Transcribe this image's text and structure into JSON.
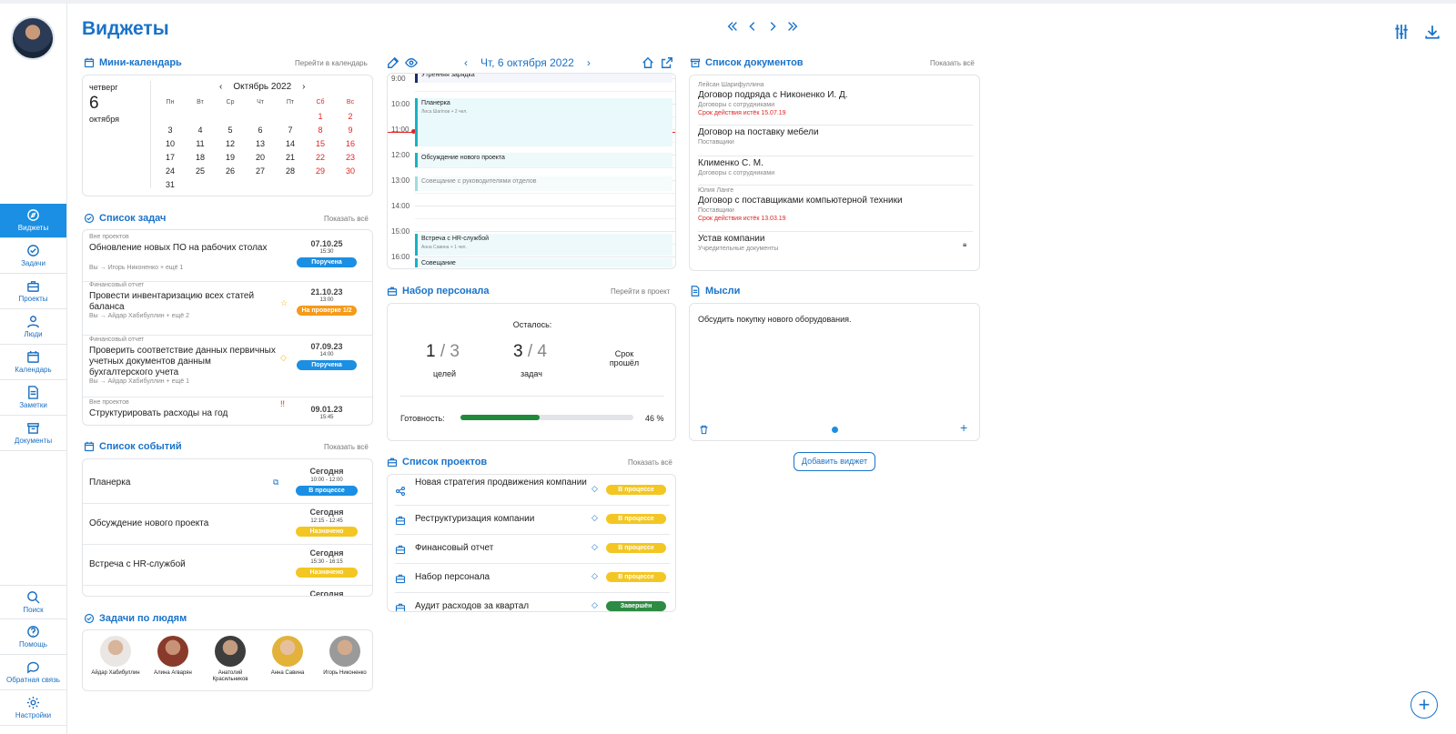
{
  "page": {
    "title": "Виджеты",
    "add_widget": "Добавить виджет"
  },
  "sidebar": {
    "items": [
      {
        "label": "Виджеты",
        "icon": "compass-icon",
        "active": true
      },
      {
        "label": "Задачи",
        "icon": "check-icon"
      },
      {
        "label": "Проекты",
        "icon": "briefcase-icon"
      },
      {
        "label": "Люди",
        "icon": "person-icon"
      },
      {
        "label": "Календарь",
        "icon": "calendar-icon"
      },
      {
        "label": "Заметки",
        "icon": "note-icon"
      },
      {
        "label": "Документы",
        "icon": "archive-icon"
      }
    ],
    "bottom": [
      {
        "label": "Поиск",
        "icon": "search-icon"
      },
      {
        "label": "Помощь",
        "icon": "help-icon"
      },
      {
        "label": "Обратная связь",
        "icon": "chat-icon"
      },
      {
        "label": "Настройки",
        "icon": "gear-icon"
      }
    ]
  },
  "mini_calendar": {
    "title": "Мини-календарь",
    "link": "Перейти в календарь",
    "weekday": "четверг",
    "day": "6",
    "month": "октября",
    "month_year": "Октябрь 2022",
    "weekdays": [
      "Пн",
      "Вт",
      "Ср",
      "Чт",
      "Пт",
      "Сб",
      "Вс"
    ],
    "weeks": [
      [
        "",
        "",
        "",
        "",
        "",
        "1",
        "2"
      ],
      [
        "3",
        "4",
        "5",
        "6",
        "7",
        "8",
        "9"
      ],
      [
        "10",
        "11",
        "12",
        "13",
        "14",
        "15",
        "16"
      ],
      [
        "17",
        "18",
        "19",
        "20",
        "21",
        "22",
        "23"
      ],
      [
        "24",
        "25",
        "26",
        "27",
        "28",
        "29",
        "30"
      ],
      [
        "31",
        "",
        "",
        "",
        "",
        "",
        ""
      ]
    ]
  },
  "tasks": {
    "title": "Список задач",
    "link": "Показать всё",
    "items": [
      {
        "project": "Вне проектов",
        "name": "Обновление новых ПО на рабочих столах",
        "people": "Вы → Игорь Никоненко + ещё 1",
        "date": "07.10.25",
        "time": "15:30",
        "status": "Поручена",
        "color": "b-blue",
        "icon": ""
      },
      {
        "project": "Финансовый отчет",
        "name": "Провести инвентаризацию всех статей баланса",
        "people": "Вы → Айдар Хабибуллин + ещё 2",
        "date": "21.10.23",
        "time": "13:00",
        "status": "На проверке 1/2",
        "color": "b-orange",
        "icon": "☆"
      },
      {
        "project": "Финансовый отчет",
        "name": "Проверить соответствие данных первичных учетных документов данным бухгалтерского учета",
        "people": "Вы → Айдар Хабибуллин + ещё 1",
        "date": "07.09.23",
        "time": "14:00",
        "status": "Поручена",
        "color": "b-blue",
        "icon": "◇"
      },
      {
        "project": "Вне проектов",
        "name": "Структурировать расходы на год",
        "people": "",
        "date": "09.01.23",
        "time": "15:45",
        "status": "",
        "color": "b-yellow",
        "icon": "!!"
      }
    ]
  },
  "events": {
    "title": "Список событий",
    "link": "Показать всё",
    "items": [
      {
        "name": "Планерка",
        "day": "Сегодня",
        "time": "10:00 - 12:00",
        "status": "В процессе",
        "color": "b-blue"
      },
      {
        "name": "Обсуждение нового проекта",
        "day": "Сегодня",
        "time": "12:15 - 12:45",
        "status": "Назначено",
        "color": "b-yellow"
      },
      {
        "name": "Встреча с HR-службой",
        "day": "Сегодня",
        "time": "15:30 - 16:15",
        "status": "Назначено",
        "color": "b-yellow"
      },
      {
        "name": "",
        "day": "Сегодня",
        "time": "",
        "status": "",
        "color": ""
      }
    ]
  },
  "people_tasks": {
    "title": "Задачи по людям",
    "people": [
      {
        "name": "Айдар Хабибуллин",
        "bg": "#e9e6e3",
        "skin": "#d8b59a"
      },
      {
        "name": "Алина Агварян",
        "bg": "#8a3a2a",
        "skin": "#c79278"
      },
      {
        "name": "Анатолий Красильников",
        "bg": "#3d3d3d",
        "skin": "#c49c80"
      },
      {
        "name": "Анна Савина",
        "bg": "#e2b23a",
        "skin": "#e6c09e"
      },
      {
        "name": "Игорь Никоненко",
        "bg": "#9a9a9a",
        "skin": "#d4aa8d"
      }
    ]
  },
  "day_calendar": {
    "date": "Чт, 6 октября 2022",
    "hours": [
      "9:00",
      "10:00",
      "11:00",
      "12:00",
      "13:00",
      "14:00",
      "15:00",
      "16:00"
    ],
    "events": [
      {
        "name": "Утренняя зарядка",
        "sub": ""
      },
      {
        "name": "Планерка",
        "sub": "Лиса Шагіпов + 2 чел."
      },
      {
        "name": "Обсуждение нового проекта",
        "sub": ""
      },
      {
        "name": "Совещание с руководителями отделов",
        "sub": ""
      },
      {
        "name": "Встреча с HR-службой",
        "sub": "Анна Савина + 1 чел."
      },
      {
        "name": "Совещание",
        "sub": ""
      }
    ]
  },
  "recruitment": {
    "title": "Набор персонала",
    "link": "Перейти в проект",
    "remaining": "Осталось:",
    "goals_done": "1",
    "goals_total": "3",
    "goals_label": "целей",
    "tasks_done": "3",
    "tasks_total": "4",
    "tasks_label": "задач",
    "deadline": "Срок прошёл",
    "readiness_label": "Готовность:",
    "readiness": "46 %",
    "readiness_value": 46
  },
  "projects": {
    "title": "Список проектов",
    "link": "Показать всё",
    "items": [
      {
        "name": "Новая стратегия продвижения компании",
        "status": "В процессе",
        "color": "b-yellow",
        "icon": "share-icon"
      },
      {
        "name": "Реструктуризация компании",
        "status": "В процессе",
        "color": "b-yellow",
        "icon": "briefcase-icon"
      },
      {
        "name": "Финансовый отчет",
        "status": "В процессе",
        "color": "b-yellow",
        "icon": "briefcase-icon"
      },
      {
        "name": "Набор персонала",
        "status": "В процессе",
        "color": "b-yellow",
        "icon": "briefcase-icon"
      },
      {
        "name": "Аудит расходов за квартал",
        "status": "Завершён",
        "color": "b-green",
        "icon": "briefcase-icon"
      }
    ]
  },
  "documents": {
    "title": "Список документов",
    "link": "Показать всё",
    "items": [
      {
        "author": "Лейсан Шарифуллина",
        "name": "Договор подряда с Никоненко И. Д.",
        "type": "Договоры с сотрудниками",
        "expiry": "Срок действия истёк 15.07.19",
        "lock": false
      },
      {
        "author": "",
        "name": "Договор на поставку мебели",
        "type": "Поставщики",
        "expiry": "",
        "lock": false
      },
      {
        "author": "",
        "name": "Клименко С. М.",
        "type": "Договоры с сотрудниками",
        "expiry": "",
        "lock": false
      },
      {
        "author": "Юлия Ланге",
        "name": "Договор с поставщиками компьютерной техники",
        "type": "Поставщики",
        "expiry": "Срок действия истёк 13.03.19",
        "lock": false
      },
      {
        "author": "",
        "name": "Устав компании",
        "type": "Учредительные документы",
        "expiry": "",
        "lock": true
      }
    ]
  },
  "thoughts": {
    "title": "Мысли",
    "text": "Обсудить покупку нового оборудования."
  }
}
